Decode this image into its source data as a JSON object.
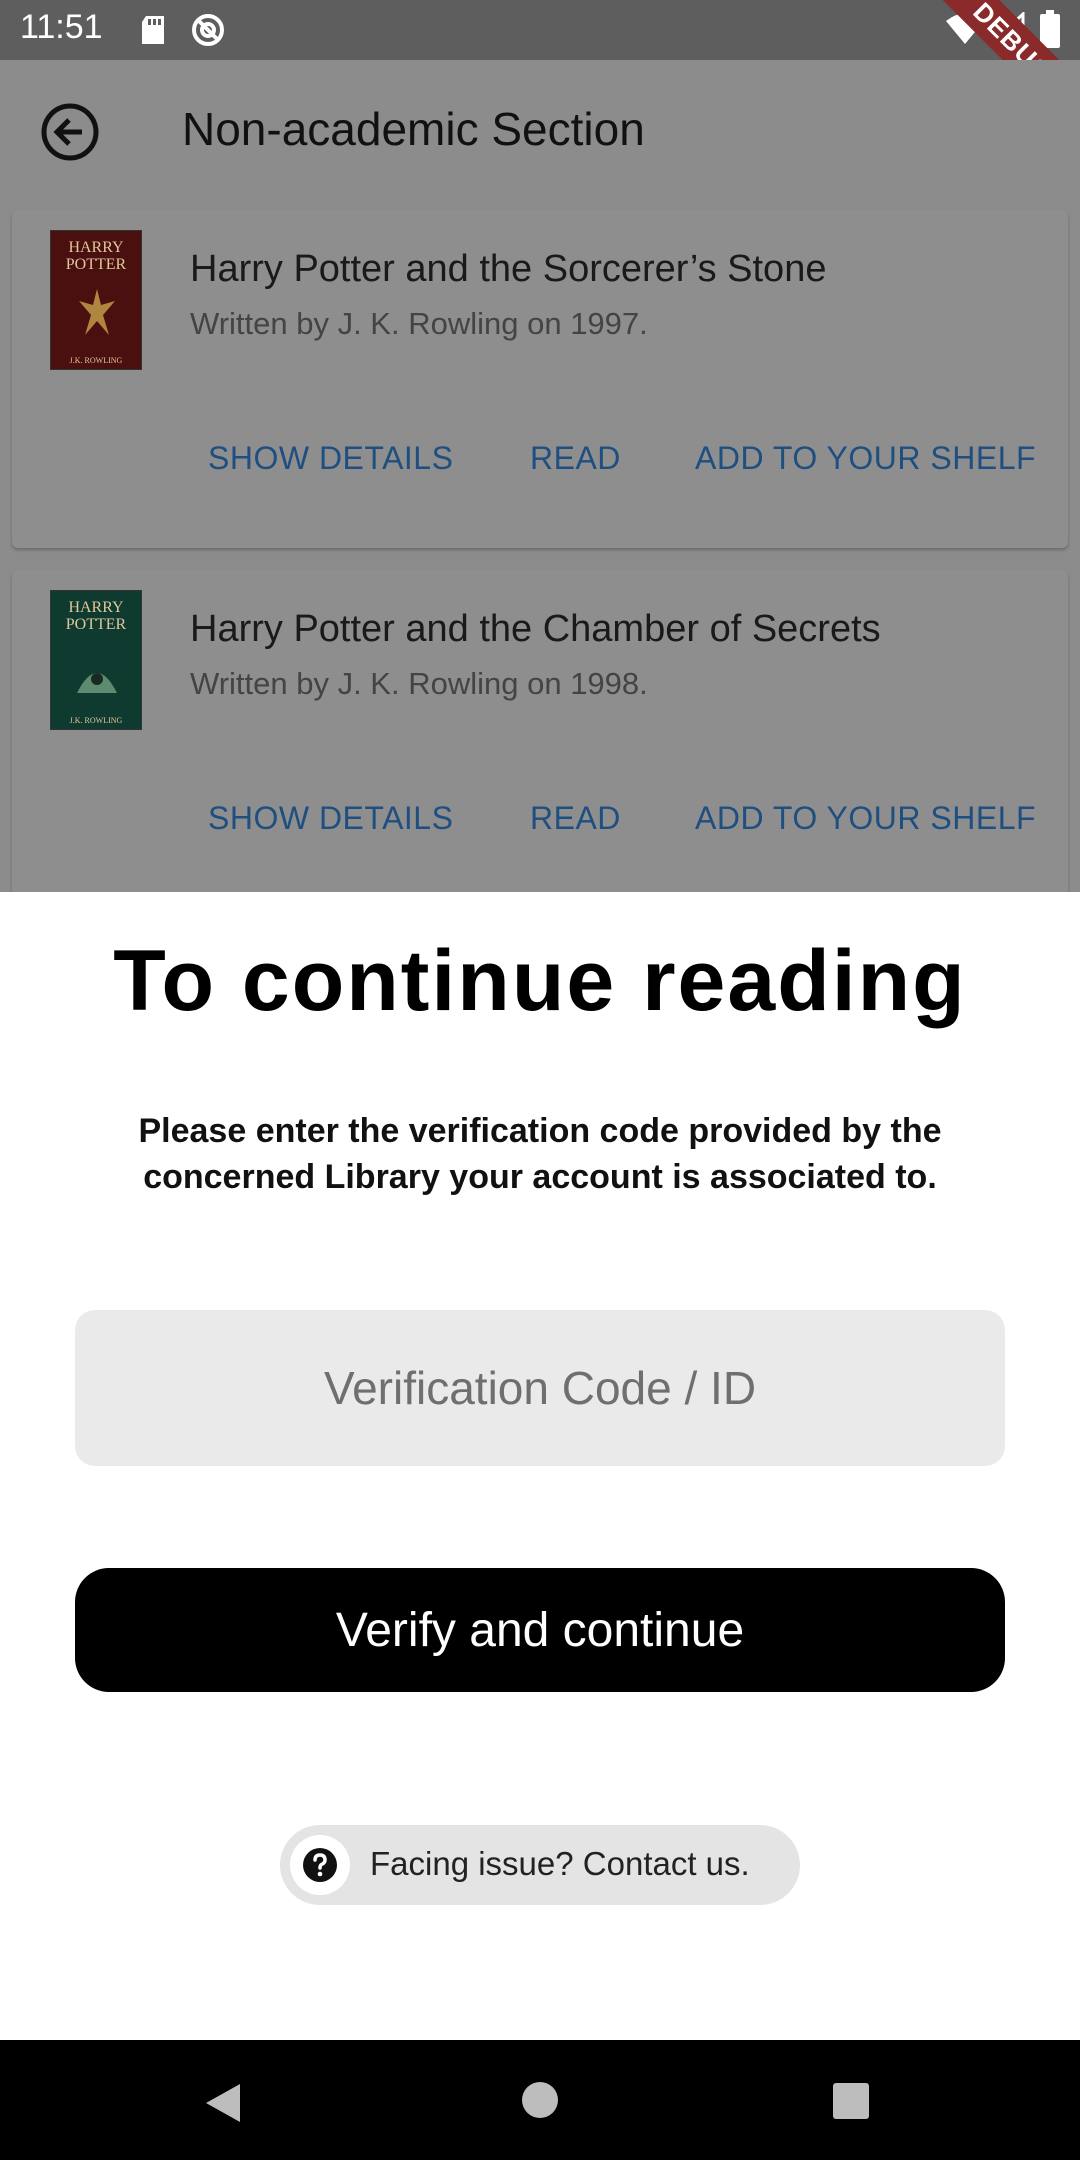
{
  "status_bar": {
    "time": "11:51",
    "debug_label": "DEBUG"
  },
  "app_bar": {
    "title": "Non-academic Section"
  },
  "books": [
    {
      "cover_title": "HARRY POTTER",
      "cover_author": "J.K. ROWLING",
      "title": "Harry Potter and the Sorcerer’s Stone",
      "subtitle": "Written by J. K. Rowling on 1997.",
      "actions": [
        "SHOW DETAILS",
        "READ",
        "ADD TO YOUR SHELF"
      ]
    },
    {
      "cover_title": "HARRY POTTER",
      "cover_author": "J.K. ROWLING",
      "title": "Harry Potter and the Chamber of Secrets",
      "subtitle": "Written by J. K. Rowling on 1998.",
      "actions": [
        "SHOW DETAILS",
        "READ",
        "ADD TO YOUR SHELF"
      ]
    }
  ],
  "sheet": {
    "title": "To continue reading",
    "description": "Please enter the verification code provided by the concerned Library your account is associated to.",
    "code_placeholder": "Verification Code / ID",
    "code_value": "",
    "verify_label": "Verify and continue",
    "contact_label": "Facing issue? Contact us."
  },
  "colors": {
    "action_link": "#1e4f80",
    "verify_button": "#000000",
    "scrim": "#8c8c8c",
    "debug_ribbon": "#8a2a2a"
  },
  "icons": {
    "back": "arrow-left-circle-icon",
    "contact": "help-circle-icon",
    "nav_back": "triangle-back-icon",
    "nav_home": "circle-home-icon",
    "nav_recent": "square-recent-icon"
  }
}
